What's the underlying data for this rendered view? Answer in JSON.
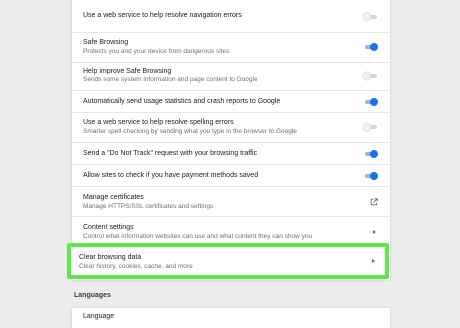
{
  "privacy": {
    "items": [
      {
        "title": "Use a web service to help resolve navigation errors",
        "control": "toggle",
        "state": "off"
      },
      {
        "title": "Safe Browsing",
        "subtitle": "Protects you and your device from dangerous sites",
        "control": "toggle",
        "state": "on"
      },
      {
        "title": "Help improve Safe Browsing",
        "subtitle": "Sends some system information and page content to Google",
        "control": "toggle",
        "state": "off"
      },
      {
        "title": "Automatically send usage statistics and crash reports to Google",
        "control": "toggle",
        "state": "on"
      },
      {
        "title": "Use a web service to help resolve spelling errors",
        "subtitle": "Smarter spell-checking by sending what you type in the browser to Google",
        "control": "toggle",
        "state": "off"
      },
      {
        "title": "Send a \"Do Not Track\" request with your browsing traffic",
        "control": "toggle",
        "state": "on"
      },
      {
        "title": "Allow sites to check if you have payment methods saved",
        "control": "toggle",
        "state": "on"
      },
      {
        "title": "Manage certificates",
        "subtitle": "Manage HTTPS/SSL certificates and settings",
        "control": "external",
        "icon": "open-in-new-icon"
      },
      {
        "title": "Content settings",
        "subtitle": "Control what information websites can use and what content they can show you",
        "control": "arrow",
        "icon": "chevron-right-icon"
      },
      {
        "title": "Clear browsing data",
        "subtitle": "Clear history, cookies, cache, and more",
        "control": "arrow",
        "icon": "chevron-right-icon",
        "highlighted": true
      }
    ]
  },
  "languages": {
    "heading": "Languages",
    "first_item": "Language"
  },
  "colors": {
    "toggle_on": "#1a73e8",
    "highlight": "#5ee84a",
    "background": "#ececec"
  }
}
